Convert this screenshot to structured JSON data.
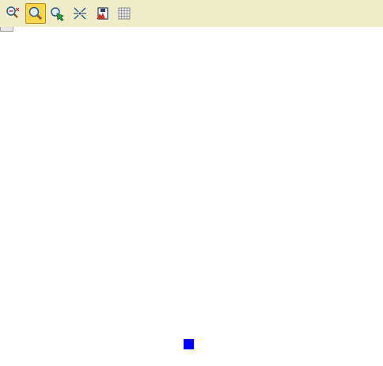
{
  "toolbar": {
    "background": "#efecca",
    "tools": [
      {
        "name": "zoom-out-icon",
        "active": false
      },
      {
        "name": "zoom-in-icon",
        "active": true
      },
      {
        "name": "pan-icon",
        "active": false
      },
      {
        "name": "fit-extent-icon",
        "active": false
      },
      {
        "name": "save-map-icon",
        "active": false
      },
      {
        "name": "grid-table-icon",
        "active": false
      }
    ],
    "active_color": "#f7d84a"
  },
  "canvas": {
    "background": "#ffffff",
    "marker_color": "#0000ff"
  }
}
